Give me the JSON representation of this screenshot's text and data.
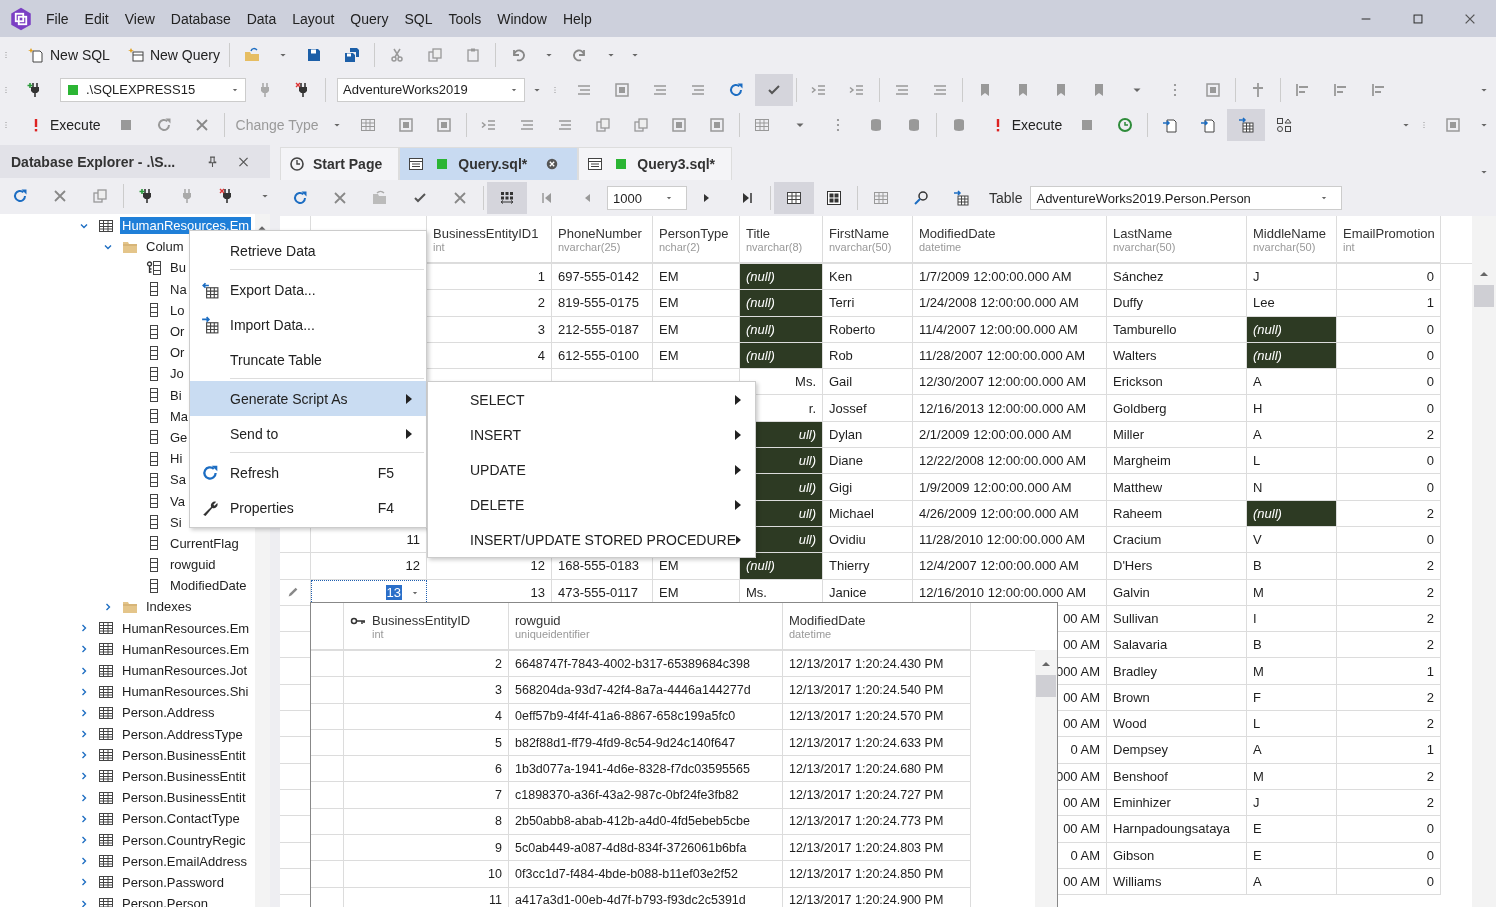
{
  "menu": [
    "File",
    "Edit",
    "View",
    "Database",
    "Data",
    "Layout",
    "Query",
    "SQL",
    "Tools",
    "Window",
    "Help"
  ],
  "toolbar": {
    "new_sql": "New SQL",
    "new_query": "New Query",
    "server": ".\\SQLEXPRESS15",
    "database": "AdventureWorks2019",
    "execute": "Execute",
    "change_type": {
      "label": "Change Type",
      "disabled": true
    },
    "execute_2": "Execute"
  },
  "explorer": {
    "title": "Database Explorer - .\\S...",
    "tree": [
      {
        "label": "HumanResources.Em",
        "kind": "table",
        "expanded": true,
        "selected": true,
        "children": [
          {
            "label": "Colum",
            "kind": "folder",
            "expanded": true,
            "selected": false,
            "children": [
              {
                "label": "Bu",
                "kind": "key_column",
                "selected": false
              },
              {
                "label": "Na",
                "kind": "column",
                "selected": false
              },
              {
                "label": "Lo",
                "kind": "column",
                "selected": false
              },
              {
                "label": "Or",
                "kind": "column",
                "selected": false
              },
              {
                "label": "Or",
                "kind": "column",
                "selected": false
              },
              {
                "label": "Jo",
                "kind": "column",
                "selected": false
              },
              {
                "label": "Bi",
                "kind": "column",
                "selected": false
              },
              {
                "label": "Ma",
                "kind": "column",
                "selected": false
              },
              {
                "label": "Ge",
                "kind": "column",
                "selected": false
              },
              {
                "label": "Hi",
                "kind": "column",
                "selected": false
              },
              {
                "label": "Sa",
                "kind": "column",
                "selected": false
              },
              {
                "label": "Va",
                "kind": "column",
                "selected": false
              },
              {
                "label": "Si",
                "kind": "column",
                "selected": false
              },
              {
                "label": "CurrentFlag",
                "kind": "column",
                "selected": false
              },
              {
                "label": "rowguid",
                "kind": "column",
                "selected": false
              },
              {
                "label": "ModifiedDate",
                "kind": "column",
                "selected": false
              }
            ]
          },
          {
            "label": "Indexes",
            "kind": "folder",
            "expanded": false,
            "selected": false
          }
        ]
      },
      {
        "label": "HumanResources.Em",
        "kind": "table",
        "expanded": false,
        "selected": false
      },
      {
        "label": "HumanResources.Em",
        "kind": "table",
        "expanded": false,
        "selected": false
      },
      {
        "label": "HumanResources.Jot",
        "kind": "table",
        "expanded": false,
        "selected": false
      },
      {
        "label": "HumanResources.Shi",
        "kind": "table",
        "expanded": false,
        "selected": false
      },
      {
        "label": "Person.Address",
        "kind": "table",
        "expanded": false,
        "selected": false
      },
      {
        "label": "Person.AddressType",
        "kind": "table",
        "expanded": false,
        "selected": false
      },
      {
        "label": "Person.BusinessEntit",
        "kind": "table",
        "expanded": false,
        "selected": false
      },
      {
        "label": "Person.BusinessEntit",
        "kind": "table",
        "expanded": false,
        "selected": false
      },
      {
        "label": "Person.BusinessEntit",
        "kind": "table",
        "expanded": false,
        "selected": false
      },
      {
        "label": "Person.ContactType",
        "kind": "table",
        "expanded": false,
        "selected": false
      },
      {
        "label": "Person.CountryRegic",
        "kind": "table",
        "expanded": false,
        "selected": false
      },
      {
        "label": "Person.EmailAddress",
        "kind": "table",
        "expanded": false,
        "selected": false
      },
      {
        "label": "Person.Password",
        "kind": "table",
        "expanded": false,
        "selected": false
      },
      {
        "label": "Person.Person",
        "kind": "table",
        "expanded": false,
        "selected": false
      }
    ]
  },
  "tabs": [
    {
      "label": "Start Page",
      "kind": "start",
      "selected": false
    },
    {
      "label": "Query.sql*",
      "kind": "query",
      "selected": true
    },
    {
      "label": "Query3.sql*",
      "kind": "query",
      "selected": false
    }
  ],
  "grid_toolbar": {
    "row_limit": "1000",
    "table_label": "Table",
    "table": "AdventureWorks2019.Person.Person"
  },
  "grid": {
    "columns": [
      {
        "name": "BusinessEntityID1",
        "type": "int"
      },
      {
        "name": "PhoneNumber",
        "type": "nvarchar(25)"
      },
      {
        "name": "PersonType",
        "type": "nchar(2)"
      },
      {
        "name": "Title",
        "type": "nvarchar(8)"
      },
      {
        "name": "FirstName",
        "type": "nvarchar(50)"
      },
      {
        "name": "ModifiedDate",
        "type": "datetime"
      },
      {
        "name": "LastName",
        "type": "nvarchar(50)"
      },
      {
        "name": "MiddleName",
        "type": "nvarchar(50)"
      },
      {
        "name": "EmailPromotion",
        "type": "int"
      }
    ],
    "rows": [
      {
        "id": null,
        "editing": false,
        "cells": [
          "1",
          "697-555-0142",
          "EM",
          {
            "text": "(null)",
            "kind": "null"
          },
          "Ken",
          "1/7/2009 12:00:00.000 AM",
          "Sánchez",
          "J",
          "0"
        ]
      },
      {
        "id": null,
        "editing": false,
        "cells": [
          "2",
          "819-555-0175",
          "EM",
          {
            "text": "(null)",
            "kind": "null"
          },
          "Terri",
          "1/24/2008 12:00:00.000 AM",
          "Duffy",
          "Lee",
          "1"
        ]
      },
      {
        "id": null,
        "editing": false,
        "cells": [
          "3",
          "212-555-0187",
          "EM",
          {
            "text": "(null)",
            "kind": "null"
          },
          "Roberto",
          "11/4/2007 12:00:00.000 AM",
          "Tamburello",
          {
            "text": "(null)",
            "kind": "null"
          },
          "0"
        ]
      },
      {
        "id": null,
        "editing": false,
        "cells": [
          "4",
          "612-555-0100",
          "EM",
          {
            "text": "(null)",
            "kind": "null"
          },
          "Rob",
          "11/28/2007 12:00:00.000 AM",
          "Walters",
          {
            "text": "(null)",
            "kind": "null"
          },
          "0"
        ]
      },
      {
        "id": null,
        "editing": false,
        "cells": [
          null,
          null,
          null,
          {
            "text": "Ms.",
            "kind": "cut"
          },
          "Gail",
          "12/30/2007 12:00:00.000 AM",
          "Erickson",
          "A",
          "0"
        ]
      },
      {
        "id": null,
        "editing": false,
        "cells": [
          null,
          null,
          null,
          {
            "text": "r.",
            "kind": "cut"
          },
          "Jossef",
          "12/16/2013 12:00:00.000 AM",
          "Goldberg",
          "H",
          "0"
        ]
      },
      {
        "id": null,
        "editing": false,
        "cells": [
          null,
          null,
          null,
          {
            "text": "ull)",
            "kind": "null_cut"
          },
          "Dylan",
          "2/1/2009 12:00:00.000 AM",
          "Miller",
          "A",
          "2"
        ]
      },
      {
        "id": null,
        "editing": false,
        "cells": [
          null,
          null,
          null,
          {
            "text": "ull)",
            "kind": "null_cut"
          },
          "Diane",
          "12/22/2008 12:00:00.000 AM",
          "Margheim",
          "L",
          "0"
        ]
      },
      {
        "id": null,
        "editing": false,
        "cells": [
          null,
          null,
          null,
          {
            "text": "ull)",
            "kind": "null_cut"
          },
          "Gigi",
          "1/9/2009 12:00:00.000 AM",
          "Matthew",
          "N",
          "0"
        ]
      },
      {
        "id": null,
        "editing": false,
        "cells": [
          null,
          null,
          null,
          {
            "text": "ull)",
            "kind": "null_cut"
          },
          "Michael",
          "4/26/2009 12:00:00.000 AM",
          "Raheem",
          {
            "text": "(null)",
            "kind": "null"
          },
          "2"
        ]
      },
      {
        "id": "11",
        "editing": false,
        "cells": [
          null,
          null,
          null,
          {
            "text": "ull)",
            "kind": "null_cut"
          },
          "Ovidiu",
          "11/28/2010 12:00:00.000 AM",
          "Cracium",
          "V",
          "0"
        ]
      },
      {
        "id": "12",
        "editing": false,
        "cells": [
          "12",
          "168-555-0183",
          "EM",
          {
            "text": "(null)",
            "kind": "null"
          },
          "Thierry",
          "12/4/2007 12:00:00.000 AM",
          "D'Hers",
          "B",
          "2"
        ]
      },
      {
        "id": "13",
        "editing": true,
        "cells": [
          "13",
          "473-555-0117",
          "EM",
          "Ms.",
          "Janice",
          "12/16/2010 12:00:00.000 AM",
          "Galvin",
          "M",
          "2"
        ]
      },
      {
        "id": null,
        "editing": false,
        "cells": [
          null,
          null,
          null,
          null,
          null,
          {
            "text": "00 AM",
            "kind": "cut"
          },
          "Sullivan",
          "I",
          "2"
        ]
      },
      {
        "id": null,
        "editing": false,
        "cells": [
          null,
          null,
          null,
          null,
          null,
          {
            "text": "00 AM",
            "kind": "cut"
          },
          "Salavaria",
          "B",
          "2"
        ]
      },
      {
        "id": null,
        "editing": false,
        "cells": [
          null,
          null,
          null,
          null,
          null,
          {
            "text": "000 AM",
            "kind": "cut"
          },
          "Bradley",
          "M",
          "1"
        ]
      },
      {
        "id": null,
        "editing": false,
        "cells": [
          null,
          null,
          null,
          null,
          null,
          {
            "text": "00 AM",
            "kind": "cut"
          },
          "Brown",
          "F",
          "2"
        ]
      },
      {
        "id": null,
        "editing": false,
        "cells": [
          null,
          null,
          null,
          null,
          null,
          {
            "text": "00 AM",
            "kind": "cut"
          },
          "Wood",
          "L",
          "2"
        ]
      },
      {
        "id": null,
        "editing": false,
        "cells": [
          null,
          null,
          null,
          null,
          null,
          {
            "text": "0 AM",
            "kind": "cut"
          },
          "Dempsey",
          "A",
          "1"
        ]
      },
      {
        "id": null,
        "editing": false,
        "cells": [
          null,
          null,
          null,
          null,
          null,
          {
            "text": "000 AM",
            "kind": "cut"
          },
          "Benshoof",
          "M",
          "2"
        ]
      },
      {
        "id": null,
        "editing": false,
        "cells": [
          null,
          null,
          null,
          null,
          null,
          {
            "text": "00 AM",
            "kind": "cut"
          },
          "Eminhizer",
          "J",
          "2"
        ]
      },
      {
        "id": null,
        "editing": false,
        "cells": [
          null,
          null,
          null,
          null,
          null,
          {
            "text": "00 AM",
            "kind": "cut"
          },
          "Harnpadoungsataya",
          "E",
          "0"
        ]
      },
      {
        "id": null,
        "editing": false,
        "cells": [
          null,
          null,
          null,
          null,
          null,
          {
            "text": "0 AM",
            "kind": "cut"
          },
          "Gibson",
          "E",
          "0"
        ]
      },
      {
        "id": null,
        "editing": false,
        "cells": [
          null,
          null,
          null,
          null,
          null,
          {
            "text": "00 AM",
            "kind": "cut"
          },
          "Williams",
          "A",
          "0"
        ]
      }
    ]
  },
  "context_menu": [
    {
      "label": "Retrieve Data",
      "kind": "plain",
      "selected": false
    },
    {
      "kind": "separator"
    },
    {
      "label": "Export Data...",
      "kind": "export",
      "selected": false
    },
    {
      "label": "Import Data...",
      "kind": "import",
      "selected": false
    },
    {
      "label": "Truncate Table",
      "kind": "plain",
      "selected": false
    },
    {
      "kind": "separator"
    },
    {
      "label": "Generate Script As",
      "kind": "submenu",
      "selected": true
    },
    {
      "label": "Send to",
      "kind": "submenu",
      "selected": false
    },
    {
      "kind": "separator"
    },
    {
      "label": "Refresh",
      "kind": "refresh",
      "shortcut": "F5",
      "selected": false
    },
    {
      "label": "Properties",
      "kind": "properties",
      "shortcut": "F4",
      "selected": false
    }
  ],
  "submenu": [
    {
      "label": "SELECT"
    },
    {
      "label": "INSERT"
    },
    {
      "label": "UPDATE"
    },
    {
      "label": "DELETE"
    },
    {
      "label": "INSERT/UPDATE STORED PROCEDURE"
    }
  ],
  "lookup": {
    "columns": [
      {
        "name": "BusinessEntityID",
        "type": "int",
        "key": true
      },
      {
        "name": "rowguid",
        "type": "uniqueidentifier",
        "key": false
      },
      {
        "name": "ModifiedDate",
        "type": "datetime",
        "key": false
      }
    ],
    "rows": [
      [
        "2",
        "6648747f-7843-4002-b317-65389684c398",
        "12/13/2017 1:20:24.430 PM"
      ],
      [
        "3",
        "568204da-93d7-42f4-8a7a-4446a144277d",
        "12/13/2017 1:20:24.540 PM"
      ],
      [
        "4",
        "0eff57b9-4f4f-41a6-8867-658c199a5fc0",
        "12/13/2017 1:20:24.570 PM"
      ],
      [
        "5",
        "b82f88d1-ff79-4fd9-8c54-9d24c140f647",
        "12/13/2017 1:20:24.633 PM"
      ],
      [
        "6",
        "1b3d077a-1941-4d6e-8328-f7dc03595565",
        "12/13/2017 1:20:24.680 PM"
      ],
      [
        "7",
        "c1898370-a36f-43a2-987c-0bf24fe3fb82",
        "12/13/2017 1:20:24.727 PM"
      ],
      [
        "8",
        "2b50abb8-abab-412b-a4d0-4fd5ebeb5cbe",
        "12/13/2017 1:20:24.773 PM"
      ],
      [
        "9",
        "5c0ab449-a087-4d8d-834f-3726061b6bfa",
        "12/13/2017 1:20:24.803 PM"
      ],
      [
        "10",
        "0f3cc1d7-f484-4bde-b088-b11ef03e2f52",
        "12/13/2017 1:20:24.850 PM"
      ],
      [
        "11",
        "a417a3d1-00eb-4d7f-b793-f93dc2c5391d",
        "12/13/2017 1:20:24.900 PM"
      ]
    ]
  }
}
